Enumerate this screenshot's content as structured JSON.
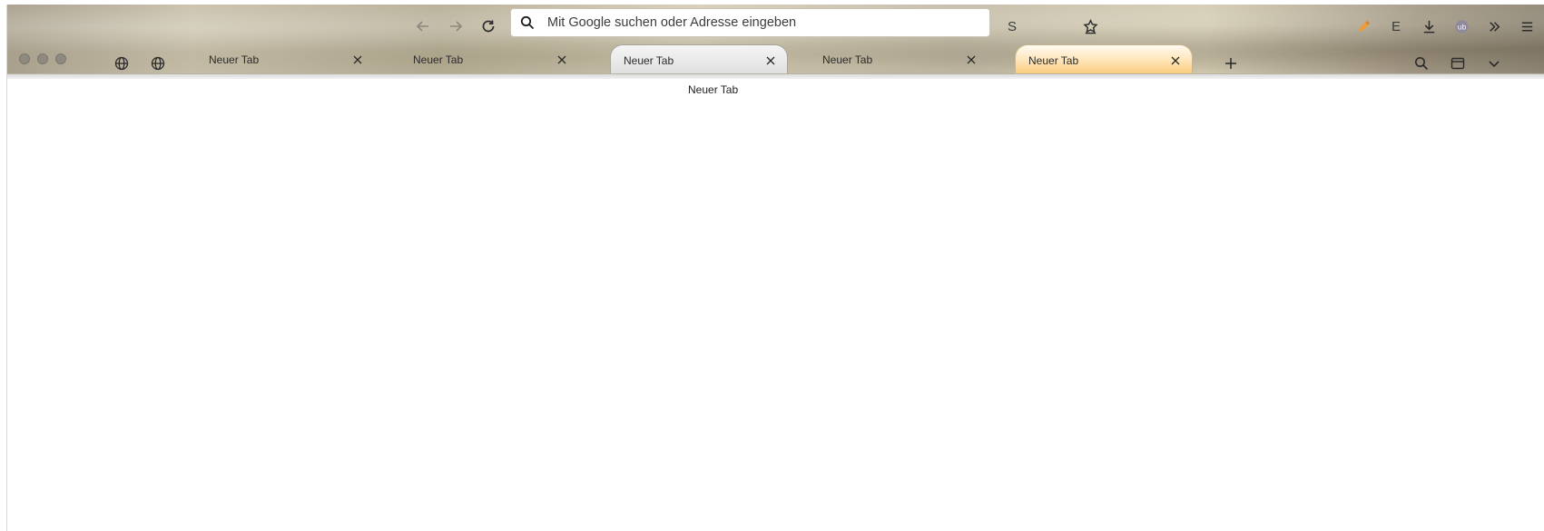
{
  "browser": {
    "urlbar": {
      "placeholder": "Mit Google suchen oder Adresse eingeben"
    },
    "toolbar_letters": {
      "s": "S",
      "e": "E"
    },
    "tabs": [
      {
        "label": "Neuer Tab",
        "state": "normal"
      },
      {
        "label": "Neuer Tab",
        "state": "normal"
      },
      {
        "label": "Neuer Tab",
        "state": "hover"
      },
      {
        "label": "Neuer Tab",
        "state": "normal"
      },
      {
        "label": "Neuer Tab",
        "state": "selected"
      }
    ],
    "tooltip": "Neuer Tab",
    "icons": {
      "back": "back-arrow-icon",
      "forward": "forward-arrow-icon",
      "reload": "reload-icon",
      "bookmark": "bookmark-star-icon",
      "downloads": "download-icon",
      "overflow": "double-chevron-icon",
      "menu": "hamburger-menu-icon",
      "search": "search-icon",
      "sidebar": "sidebar-icon",
      "list_all_tabs": "chevron-down-icon",
      "new_tab": "plus-icon",
      "pinned": "globe-icon"
    },
    "colors": {
      "selected_tab": "#ffe3b3",
      "accent_orange": "#f39a2b"
    }
  }
}
